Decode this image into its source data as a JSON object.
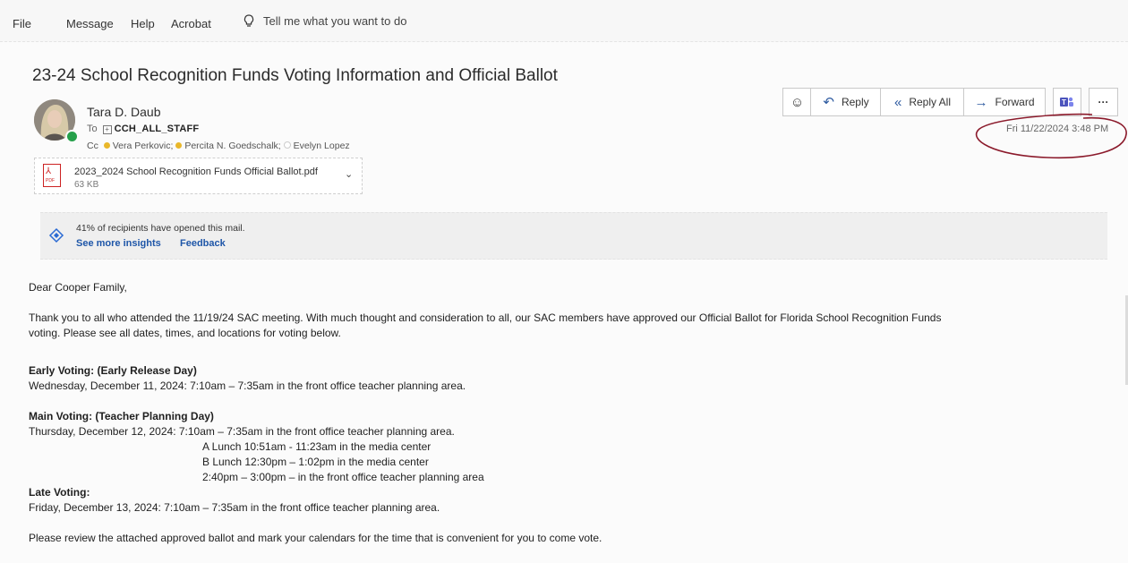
{
  "menu": {
    "items": [
      "File",
      "Message",
      "Help",
      "Acrobat"
    ],
    "tell_me": "Tell me what you want to do"
  },
  "email": {
    "subject": "23-24 School Recognition Funds Voting Information and Official Ballot",
    "sender": "Tara D. Daub",
    "to_label": "To",
    "to_value": "CCH_ALL_STAFF",
    "cc_label": "Cc",
    "cc": [
      "Vera Perkovic;",
      "Percita N. Goedschalk;",
      "Evelyn Lopez"
    ],
    "timestamp": "Fri 11/22/2024 3:48 PM"
  },
  "attachment": {
    "name": "2023_2024 School Recognition Funds Official Ballot.pdf",
    "size": "63 KB",
    "icon": "pdf-icon"
  },
  "toolbar": {
    "reply": "Reply",
    "reply_all": "Reply All",
    "forward": "Forward",
    "more": "···"
  },
  "insights": {
    "text": "41% of recipients have opened this mail.",
    "see_more": "See more insights",
    "feedback": "Feedback"
  },
  "body": {
    "greeting": "Dear Cooper Family,",
    "para1_line1": "Thank you to all who attended the 11/19/24 SAC meeting.  With much thought and consideration to all, our SAC members have approved our Official Ballot for Florida School Recognition Funds",
    "para1_line2": "voting.  Please see all dates, times, and locations for voting below.",
    "early_heading": "Early Voting: (Early Release Day)",
    "early_detail": "Wednesday, December 11, 2024:  7:10am – 7:35am in the front office teacher planning area.",
    "main_heading": "Main Voting: (Teacher Planning Day)",
    "main_detail": "Thursday, December 12, 2024:  7:10am – 7:35am in the front office teacher planning area.",
    "main_slot_a": "A Lunch 10:51am - 11:23am in the media center",
    "main_slot_b": "B Lunch 12:30pm – 1:02pm in the media center",
    "main_slot_c": "2:40pm – 3:00pm – in the front office teacher planning area",
    "late_heading": "Late Voting:",
    "late_detail": "Friday, December 13, 2024:  7:10am – 7:35am in the front office teacher planning area.",
    "closing": "Please review the attached approved ballot and mark your calendars for the time that is convenient for you to come vote."
  },
  "colors": {
    "link": "#1e56a8",
    "presence": "#25a04a",
    "annotation_ink": "#8b1a2b"
  }
}
